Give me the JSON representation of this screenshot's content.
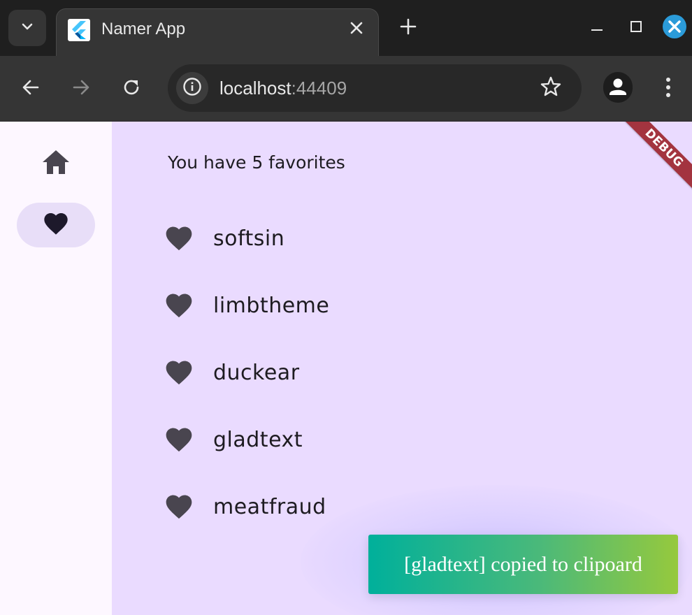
{
  "browser": {
    "tab": {
      "title": "Namer App"
    },
    "address_bar": {
      "host": "localhost",
      "port": ":44409"
    },
    "colors": {
      "tabstrip": "#1f1f1f",
      "toolbar": "#353535",
      "close_button": "#2b9bd9"
    }
  },
  "app": {
    "rail": {
      "items": [
        {
          "name": "home",
          "icon": "home-icon",
          "selected": false
        },
        {
          "name": "favorites",
          "icon": "heart-icon",
          "selected": true
        }
      ]
    },
    "favorites": {
      "summary": "You have 5 favorites",
      "items": [
        "softsin",
        "limbtheme",
        "duckear",
        "gladtext",
        "meatfraud"
      ]
    },
    "debug_banner": "DEBUG",
    "toast": {
      "message": "[gladtext] copied to clipoard",
      "gradient": [
        "#00b09b",
        "#96c93d"
      ]
    },
    "colors": {
      "background": "#eadbff",
      "rail": "#fdf7ff",
      "rail_selected": "#e8def8",
      "icon": "#49454f"
    }
  }
}
